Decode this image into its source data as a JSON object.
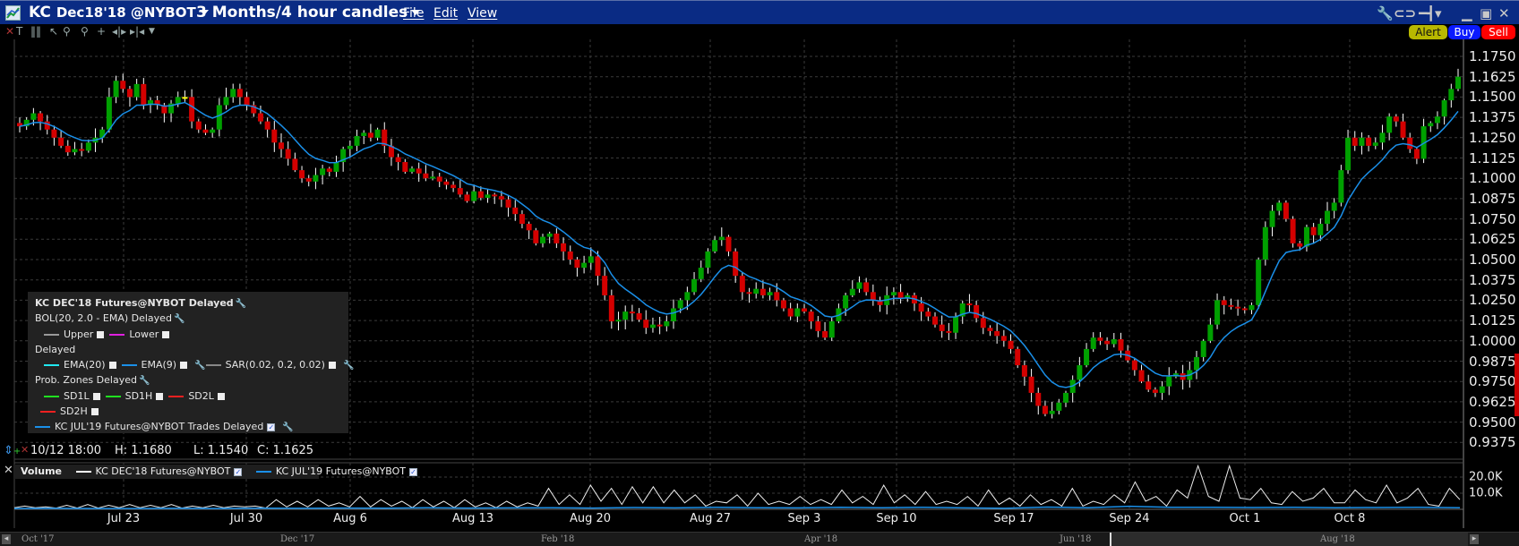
{
  "titlebar": {
    "symbol": "KC",
    "contract": "Dec18'18 @NYBOT",
    "period": "3 Months/4 hour candles",
    "menus": [
      "File",
      "Edit",
      "View"
    ]
  },
  "trade_buttons": {
    "alert": "Alert",
    "buy": "Buy",
    "sell": "Sell"
  },
  "colors": {
    "titlebar": "#0a2b84",
    "up": "#00a000",
    "down": "#d40000",
    "doji": "#ffff00",
    "ema9": "#1a8fe8",
    "alert": "#b8b800",
    "buy": "#0a1aff",
    "sell": "#ff0000"
  },
  "legend": {
    "title": "KC DEC'18 Futures@NYBOT Delayed",
    "bol": "BOL(20, 2.0 - EMA) Delayed",
    "upper": "Upper",
    "lower": "Lower",
    "delayed": "Delayed",
    "ema20": "EMA(20)",
    "ema9": "EMA(9)",
    "sar": "SAR(0.02, 0.2, 0.02)",
    "prob": "Prob. Zones Delayed",
    "sd1l": "SD1L",
    "sd1h": "SD1H",
    "sd2l": "SD2L",
    "sd2h": "SD2H",
    "jul19": "KC JUL'19 Futures@NYBOT Trades Delayed"
  },
  "info": {
    "datetime": "10/12 18:00",
    "high": "H: 1.1680",
    "low": "L: 1.1540",
    "close": "C: 1.1625"
  },
  "volume_legend": {
    "title": "Volume",
    "series1": "KC DEC'18 Futures@NYBOT",
    "series2": "KC JUL'19 Futures@NYBOT"
  },
  "price_axis": [
    "1.1750",
    "1.1625",
    "1.1500",
    "1.1375",
    "1.1250",
    "1.1125",
    "1.1000",
    "1.0875",
    "1.0750",
    "1.0625",
    "1.0500",
    "1.0375",
    "1.0250",
    "1.0125",
    "1.0000",
    "0.9875",
    "0.9750",
    "0.9625",
    "0.9500",
    "0.9375"
  ],
  "volume_axis": [
    "20.0K",
    "10.0K"
  ],
  "date_labels": [
    "Jul 23",
    "Jul 30",
    "Aug 6",
    "Aug 13",
    "Aug 20",
    "Aug 27",
    "Sep 3",
    "Sep 10",
    "Sep 17",
    "Sep 24",
    "Oct 1",
    "Oct 8"
  ],
  "scroll_labels": [
    "Oct '17",
    "Dec '17",
    "Feb '18",
    "Apr '18",
    "Jun '18",
    "Aug '18"
  ],
  "chart_data": {
    "type": "candlestick",
    "ylim": [
      0.93,
      1.18
    ],
    "closes": [
      1.132,
      1.136,
      1.14,
      1.135,
      1.13,
      1.125,
      1.12,
      1.116,
      1.118,
      1.117,
      1.122,
      1.125,
      1.13,
      1.15,
      1.16,
      1.155,
      1.15,
      1.158,
      1.145,
      1.148,
      1.145,
      1.14,
      1.146,
      1.15,
      1.15,
      1.135,
      1.13,
      1.128,
      1.13,
      1.145,
      1.15,
      1.155,
      1.15,
      1.145,
      1.14,
      1.135,
      1.13,
      1.122,
      1.118,
      1.112,
      1.105,
      1.1,
      1.098,
      1.102,
      1.106,
      1.104,
      1.11,
      1.118,
      1.12,
      1.126,
      1.128,
      1.125,
      1.13,
      1.12,
      1.113,
      1.11,
      1.104,
      1.106,
      1.103,
      1.1,
      1.101,
      1.098,
      1.096,
      1.094,
      1.09,
      1.086,
      1.092,
      1.088,
      1.09,
      1.089,
      1.087,
      1.082,
      1.078,
      1.072,
      1.068,
      1.06,
      1.064,
      1.066,
      1.06,
      1.055,
      1.05,
      1.045,
      1.048,
      1.052,
      1.04,
      1.028,
      1.012,
      1.013,
      1.018,
      1.017,
      1.013,
      1.008,
      1.01,
      1.009,
      1.012,
      1.02,
      1.025,
      1.03,
      1.038,
      1.045,
      1.055,
      1.062,
      1.064,
      1.055,
      1.04,
      1.03,
      1.029,
      1.032,
      1.028,
      1.03,
      1.025,
      1.02,
      1.015,
      1.02,
      1.018,
      1.012,
      1.006,
      1.002,
      1.012,
      1.02,
      1.028,
      1.032,
      1.036,
      1.03,
      1.025,
      1.022,
      1.028,
      1.03,
      1.026,
      1.028,
      1.023,
      1.018,
      1.015,
      1.01,
      1.006,
      1.005,
      1.015,
      1.023,
      1.022,
      1.014,
      1.008,
      1.006,
      1.003,
      1.0,
      0.995,
      0.985,
      0.978,
      0.968,
      0.96,
      0.955,
      0.957,
      0.962,
      0.968,
      0.976,
      0.985,
      0.995,
      1.002,
      1.0,
      0.998,
      1.001,
      0.994,
      0.988,
      0.982,
      0.975,
      0.97,
      0.968,
      0.972,
      0.978,
      0.98,
      0.976,
      0.982,
      0.99,
      1.0,
      1.01,
      1.025,
      1.022,
      1.021,
      1.02,
      1.019,
      1.022,
      1.05,
      1.07,
      1.08,
      1.085,
      1.075,
      1.06,
      1.058,
      1.07,
      1.065,
      1.072,
      1.08,
      1.085,
      1.105,
      1.125,
      1.12,
      1.125,
      1.12,
      1.122,
      1.128,
      1.138,
      1.135,
      1.125,
      1.118,
      1.112,
      1.132,
      1.134,
      1.138,
      1.148,
      1.155,
      1.1625
    ],
    "volume_k": [
      1,
      2,
      1,
      1.5,
      0.8,
      2.5,
      0.8,
      3,
      0.8,
      2.5,
      1,
      3,
      1,
      2.5,
      1,
      3,
      0.8,
      2,
      1,
      2.5,
      1,
      2,
      1.5,
      2,
      0.8,
      6,
      1.5,
      5,
      1.5,
      6,
      2,
      4,
      1.5,
      8,
      1.5,
      6,
      2,
      5,
      1,
      6,
      1.5,
      5,
      1,
      6,
      1.5,
      4,
      1,
      5,
      1.5,
      4,
      2,
      13,
      3,
      9,
      3,
      15,
      5,
      13,
      3,
      14,
      4,
      14,
      4,
      12,
      4,
      9,
      2,
      5,
      4,
      9,
      2,
      10,
      3,
      5,
      3,
      8,
      3,
      6,
      3,
      12,
      4,
      8,
      3,
      15,
      4,
      9,
      3,
      11,
      3,
      5,
      3,
      8,
      2,
      12,
      3,
      7,
      2,
      9,
      3,
      6,
      2,
      13,
      2,
      5,
      3,
      9,
      4,
      17,
      5,
      8,
      2,
      12,
      7,
      27,
      8,
      5,
      27,
      7,
      6,
      13,
      4,
      3,
      11,
      5,
      7,
      13,
      4,
      4,
      12,
      6,
      4,
      15,
      4,
      7,
      13,
      3,
      2,
      13,
      6
    ],
    "volume2_k": [
      0.5,
      0.6,
      0.5,
      0.5,
      0.6,
      0.5,
      0.7,
      0.6,
      0.8,
      0.7,
      1.0,
      0.8,
      0.9,
      1.0,
      0.8,
      1.1,
      0.9,
      1.2,
      1.0,
      0.9,
      1.3,
      1.0,
      1.2,
      0.9,
      0.6,
      1.4,
      1.0,
      1.9,
      1.2,
      1.3,
      1.1,
      1.2,
      1.0,
      1.1,
      1.3,
      1.0
    ]
  }
}
